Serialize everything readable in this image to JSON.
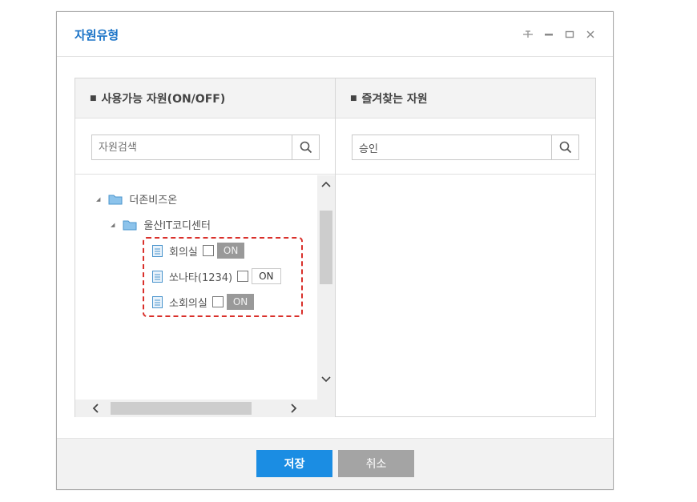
{
  "dialog": {
    "title": "자원유형",
    "controls": [
      "pin-icon",
      "minimize-icon",
      "maximize-icon",
      "close-icon"
    ]
  },
  "left_panel": {
    "heading": "사용가능 자원(ON/OFF)",
    "search": {
      "value": "",
      "placeholder": "자원검색"
    },
    "tree": {
      "root": {
        "label": "더존비즈온",
        "expanded": true
      },
      "child": {
        "label": "울산IT코디센터",
        "expanded": true
      },
      "resources": [
        {
          "label": "회의실",
          "checked": false,
          "toggle": "ON",
          "style": "dark"
        },
        {
          "label": "쏘나타(1234)",
          "checked": false,
          "toggle": "ON",
          "style": "light"
        },
        {
          "label": "소회의실",
          "checked": false,
          "toggle": "ON",
          "style": "dark"
        }
      ]
    }
  },
  "right_panel": {
    "heading": "즐겨찾는 자원",
    "search": {
      "value": "승인",
      "placeholder": ""
    }
  },
  "footer": {
    "save_label": "저장",
    "cancel_label": "취소"
  },
  "colors": {
    "title": "#1a73c7",
    "save": "#1b8de3",
    "cancel": "#a4a4a4",
    "highlight": "#d9302b",
    "folder": "#5ba4d8"
  }
}
